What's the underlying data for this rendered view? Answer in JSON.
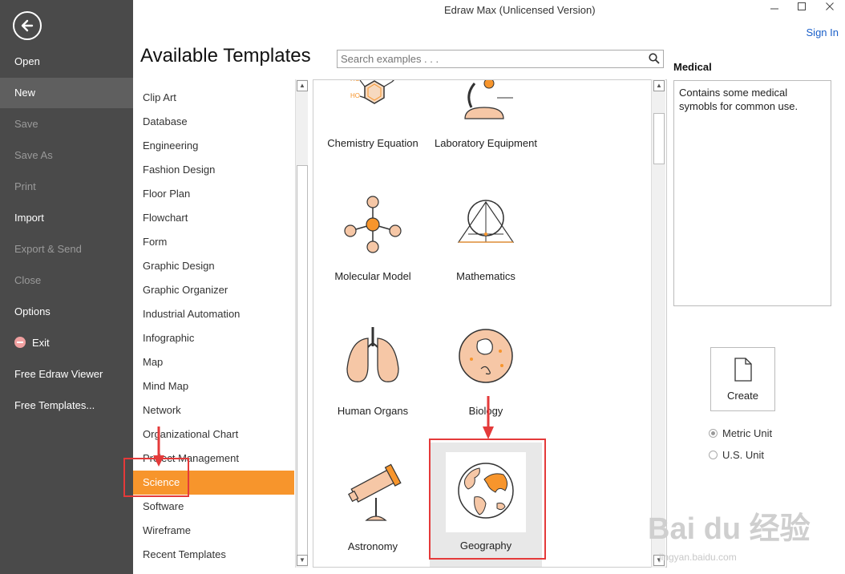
{
  "app": {
    "title": "Edraw Max (Unlicensed Version)",
    "sign_in": "Sign In"
  },
  "nav": {
    "items": [
      {
        "label": "Open",
        "state": "normal"
      },
      {
        "label": "New",
        "state": "active"
      },
      {
        "label": "Save",
        "state": "disabled"
      },
      {
        "label": "Save As",
        "state": "disabled"
      },
      {
        "label": "Print",
        "state": "disabled"
      },
      {
        "label": "Import",
        "state": "normal"
      },
      {
        "label": "Export & Send",
        "state": "disabled"
      },
      {
        "label": "Close",
        "state": "disabled"
      },
      {
        "label": "Options",
        "state": "normal"
      },
      {
        "label": "Exit",
        "state": "normal",
        "icon": "exit-icon"
      },
      {
        "label": "Free Edraw Viewer",
        "state": "normal"
      },
      {
        "label": "Free Templates...",
        "state": "normal"
      }
    ]
  },
  "header": {
    "title": "Available Templates"
  },
  "search": {
    "placeholder": "Search examples . . ."
  },
  "categories": {
    "items": [
      "Clip Art",
      "Database",
      "Engineering",
      "Fashion Design",
      "Floor Plan",
      "Flowchart",
      "Form",
      "Graphic Design",
      "Graphic Organizer",
      "Industrial Automation",
      "Infographic",
      "Map",
      "Mind Map",
      "Network",
      "Organizational Chart",
      "Project Management",
      "Science",
      "Software",
      "Wireframe",
      "Recent Templates"
    ],
    "selected": "Science"
  },
  "templates": {
    "items": [
      {
        "label": "Chemistry Equation",
        "icon": "chemistry-icon"
      },
      {
        "label": "Laboratory Equipment",
        "icon": "microscope-icon"
      },
      {
        "label": "Molecular Model",
        "icon": "molecule-icon"
      },
      {
        "label": "Mathematics",
        "icon": "geometry-icon"
      },
      {
        "label": "Human Organs",
        "icon": "lungs-icon"
      },
      {
        "label": "Biology",
        "icon": "cell-icon"
      },
      {
        "label": "Astronomy",
        "icon": "telescope-icon"
      },
      {
        "label": "Geography",
        "icon": "globe-icon"
      }
    ],
    "highlighted": "Geography"
  },
  "details": {
    "heading": "Medical",
    "description": "Contains some medical symobls for common use."
  },
  "create": {
    "label": "Create"
  },
  "units": {
    "options": [
      "Metric Unit",
      "U.S. Unit"
    ],
    "selected": "Metric Unit"
  },
  "watermark": {
    "text": "Bai du 经验",
    "sub": "jingyan.baidu.com"
  },
  "colors": {
    "accent": "#f7952c",
    "sidebar": "#4a4a4a",
    "annotation": "#e43a3a",
    "link": "#1a5fc9"
  }
}
